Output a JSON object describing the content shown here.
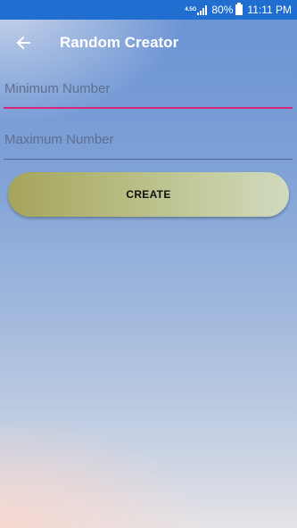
{
  "status_bar": {
    "network": "4.5G",
    "battery": "80%",
    "time": "11:11 PM",
    "background_color": "#1f6ed0"
  },
  "app_bar": {
    "back_icon": "arrow-left-icon",
    "title": "Random Creator"
  },
  "form": {
    "minimum": {
      "value": "",
      "placeholder": "Minimum Number",
      "underline_color": "#d6257d"
    },
    "maximum": {
      "value": "",
      "placeholder": "Maximum Number"
    },
    "create_label": "CREATE"
  }
}
